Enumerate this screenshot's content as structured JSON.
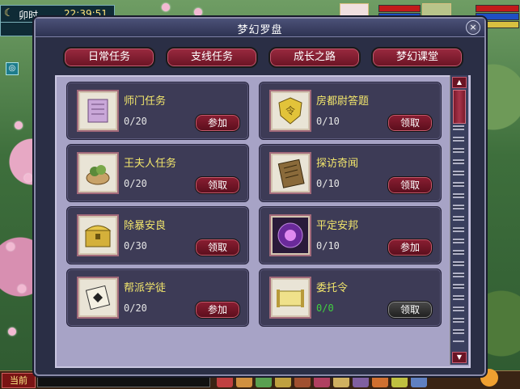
{
  "hud": {
    "shichen": "卯时",
    "clock": "22:39:51"
  },
  "dialog": {
    "title": "梦幻罗盘",
    "close_glyph": "×"
  },
  "tabs": [
    {
      "label": "日常任务"
    },
    {
      "label": "支线任务"
    },
    {
      "label": "成长之路"
    },
    {
      "label": "梦幻课堂"
    }
  ],
  "tasks": [
    {
      "title": "师门任务",
      "progress": "0/20",
      "action": "参加",
      "icon": "scroll-icon"
    },
    {
      "title": "房都尉答题",
      "progress": "0/10",
      "action": "领取",
      "icon": "shield-icon"
    },
    {
      "title": "王夫人任务",
      "progress": "0/20",
      "action": "领取",
      "icon": "bundle-icon"
    },
    {
      "title": "探访奇闻",
      "progress": "0/10",
      "action": "领取",
      "icon": "tablet-icon"
    },
    {
      "title": "除暴安良",
      "progress": "0/30",
      "action": "领取",
      "icon": "treasure-chest-icon"
    },
    {
      "title": "平定安邦",
      "progress": "0/10",
      "action": "参加",
      "icon": "orb-icon"
    },
    {
      "title": "帮派学徒",
      "progress": "0/20",
      "action": "参加",
      "icon": "banner-icon"
    },
    {
      "title": "委托令",
      "progress": "0/0",
      "action": "领取",
      "icon": "edict-scroll-icon"
    }
  ],
  "bottom": {
    "chat_channel": "当前"
  }
}
